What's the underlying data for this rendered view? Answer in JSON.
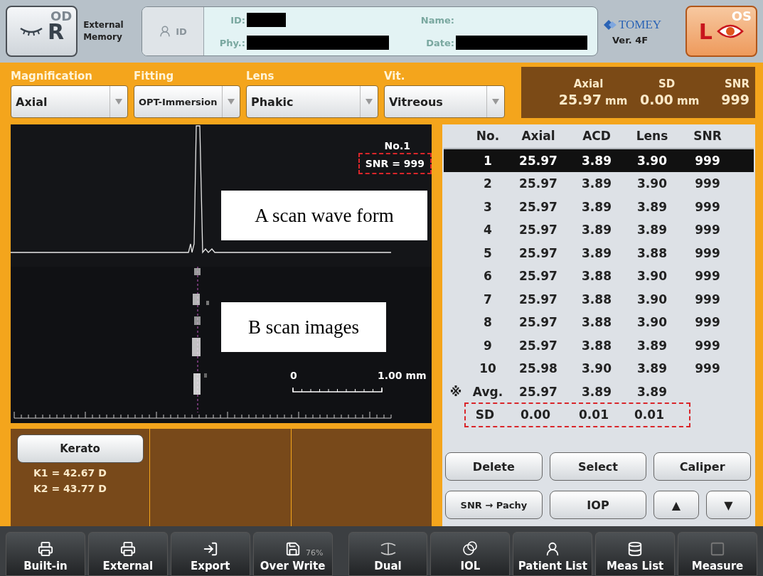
{
  "header": {
    "eye_buttons": [
      {
        "label": "R",
        "ghost": "OD",
        "selected": false
      },
      {
        "label": "L",
        "ghost": "OS",
        "selected": true
      }
    ],
    "memory": "External Memory",
    "id_button": "ID",
    "patient": {
      "id_label": "ID:",
      "phy_label": "Phy.:",
      "name_label": "Name:",
      "date_label": "Date:"
    },
    "brand": "TOMEY",
    "version": "Ver. 4F"
  },
  "settings": [
    {
      "label": "Magnification",
      "value": "Axial"
    },
    {
      "label": "Fitting",
      "value": "OPT-Immersion"
    },
    {
      "label": "Lens",
      "value": "Phakic"
    },
    {
      "label": "Vit.",
      "value": "Vitreous"
    }
  ],
  "result": [
    {
      "label": "Axial",
      "value": "25.97",
      "unit": "mm"
    },
    {
      "label": "SD",
      "value": "0.00",
      "unit": "mm"
    },
    {
      "label": "SNR",
      "value": "999"
    }
  ],
  "scan": {
    "number": "No.1",
    "snr": "SNR = 999",
    "snr_highlighted": true,
    "a_label": "A scan wave form",
    "b_label": "B scan images",
    "scale_start": "0",
    "scale_end": "1.00 mm"
  },
  "table": {
    "columns": [
      "No.",
      "Axial",
      "ACD",
      "Lens",
      "SNR"
    ],
    "rows": [
      {
        "cells": [
          "1",
          "25.97",
          "3.89",
          "3.90",
          "999"
        ],
        "selected": true
      },
      {
        "cells": [
          "2",
          "25.97",
          "3.89",
          "3.90",
          "999"
        ],
        "selected": false
      },
      {
        "cells": [
          "3",
          "25.97",
          "3.89",
          "3.89",
          "999"
        ],
        "selected": false
      },
      {
        "cells": [
          "4",
          "25.97",
          "3.89",
          "3.89",
          "999"
        ],
        "selected": false
      },
      {
        "cells": [
          "5",
          "25.97",
          "3.89",
          "3.88",
          "999"
        ],
        "selected": false
      },
      {
        "cells": [
          "6",
          "25.97",
          "3.88",
          "3.90",
          "999"
        ],
        "selected": false
      },
      {
        "cells": [
          "7",
          "25.97",
          "3.88",
          "3.90",
          "999"
        ],
        "selected": false
      },
      {
        "cells": [
          "8",
          "25.97",
          "3.88",
          "3.90",
          "999"
        ],
        "selected": false
      },
      {
        "cells": [
          "9",
          "25.97",
          "3.88",
          "3.89",
          "999"
        ],
        "selected": false
      },
      {
        "cells": [
          "10",
          "25.98",
          "3.90",
          "3.89",
          "999"
        ],
        "selected": false
      }
    ],
    "avg": {
      "mark": "※",
      "cells": [
        "Avg.",
        "25.97",
        "3.89",
        "3.89"
      ]
    },
    "sd": {
      "cells": [
        "SD",
        "0.00",
        "0.01",
        "0.01"
      ],
      "highlighted": true
    }
  },
  "kerato": {
    "button": "Kerato",
    "k1": "K1 = 42.67 D",
    "k2": "K2 = 43.77 D"
  },
  "actions": [
    {
      "label": "Delete",
      "kind": "wide"
    },
    {
      "label": "Select",
      "kind": "wide"
    },
    {
      "label": "Caliper",
      "kind": "wide"
    },
    {
      "label": "SNR → Pachy",
      "kind": "small"
    },
    {
      "label": "IOP",
      "kind": "wide"
    },
    {
      "label": "▲",
      "kind": "arrow"
    },
    {
      "label": "▼",
      "kind": "arrow"
    }
  ],
  "toolbar": [
    {
      "label": "Built-in",
      "kind": "printer"
    },
    {
      "label": "External",
      "kind": "printer"
    },
    {
      "label": "Export",
      "kind": "export"
    },
    {
      "label": "Over Write",
      "kind": "save",
      "badge": "76%"
    },
    {
      "label": "Dual",
      "kind": "dual"
    },
    {
      "label": "IOL",
      "kind": "rings"
    },
    {
      "label": "Patient List",
      "kind": "person"
    },
    {
      "label": "Meas List",
      "kind": "database"
    },
    {
      "label": "Measure",
      "kind": "square"
    }
  ]
}
